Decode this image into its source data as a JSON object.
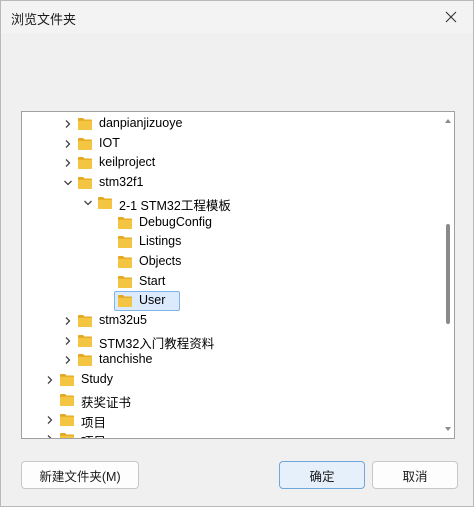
{
  "window": {
    "title": "浏览文件夹"
  },
  "tree": {
    "items": [
      {
        "label": "danpianjizuoye",
        "level": 1,
        "expandable": true,
        "expanded": false
      },
      {
        "label": "IOT",
        "level": 1,
        "expandable": true,
        "expanded": false
      },
      {
        "label": "keilproject",
        "level": 1,
        "expandable": true,
        "expanded": false
      },
      {
        "label": "stm32f1",
        "level": 1,
        "expandable": true,
        "expanded": true
      },
      {
        "label": "2-1 STM32工程模板",
        "level": 2,
        "expandable": true,
        "expanded": true
      },
      {
        "label": "DebugConfig",
        "level": 3,
        "expandable": false,
        "expanded": false
      },
      {
        "label": "Listings",
        "level": 3,
        "expandable": false,
        "expanded": false
      },
      {
        "label": "Objects",
        "level": 3,
        "expandable": false,
        "expanded": false
      },
      {
        "label": "Start",
        "level": 3,
        "expandable": false,
        "expanded": false
      },
      {
        "label": "User",
        "level": 3,
        "expandable": false,
        "expanded": false,
        "selected": true
      },
      {
        "label": "stm32u5",
        "level": 1,
        "expandable": true,
        "expanded": false
      },
      {
        "label": "STM32入门教程资料",
        "level": 1,
        "expandable": true,
        "expanded": false
      },
      {
        "label": "tanchishe",
        "level": 1,
        "expandable": true,
        "expanded": false
      },
      {
        "label": "Study",
        "level": 0,
        "expandable": true,
        "expanded": false
      },
      {
        "label": "获奖证书",
        "level": 0,
        "expandable": false,
        "expanded": false
      },
      {
        "label": "项目",
        "level": 0,
        "expandable": true,
        "expanded": false
      },
      {
        "label": "项目new",
        "level": 0,
        "expandable": true,
        "expanded": false
      }
    ]
  },
  "buttons": {
    "new_folder": "新建文件夹(M)",
    "ok": "确定",
    "cancel": "取消"
  },
  "colors": {
    "folder": "#f4c542",
    "selection": "#dbeafc",
    "selection_border": "#7fb4e8",
    "primary_button": "#e6f0fb"
  },
  "icons": {
    "close": "close-icon",
    "folder": "folder-icon",
    "chevron_right": "chevron-right-icon",
    "chevron_down": "chevron-down-icon"
  }
}
